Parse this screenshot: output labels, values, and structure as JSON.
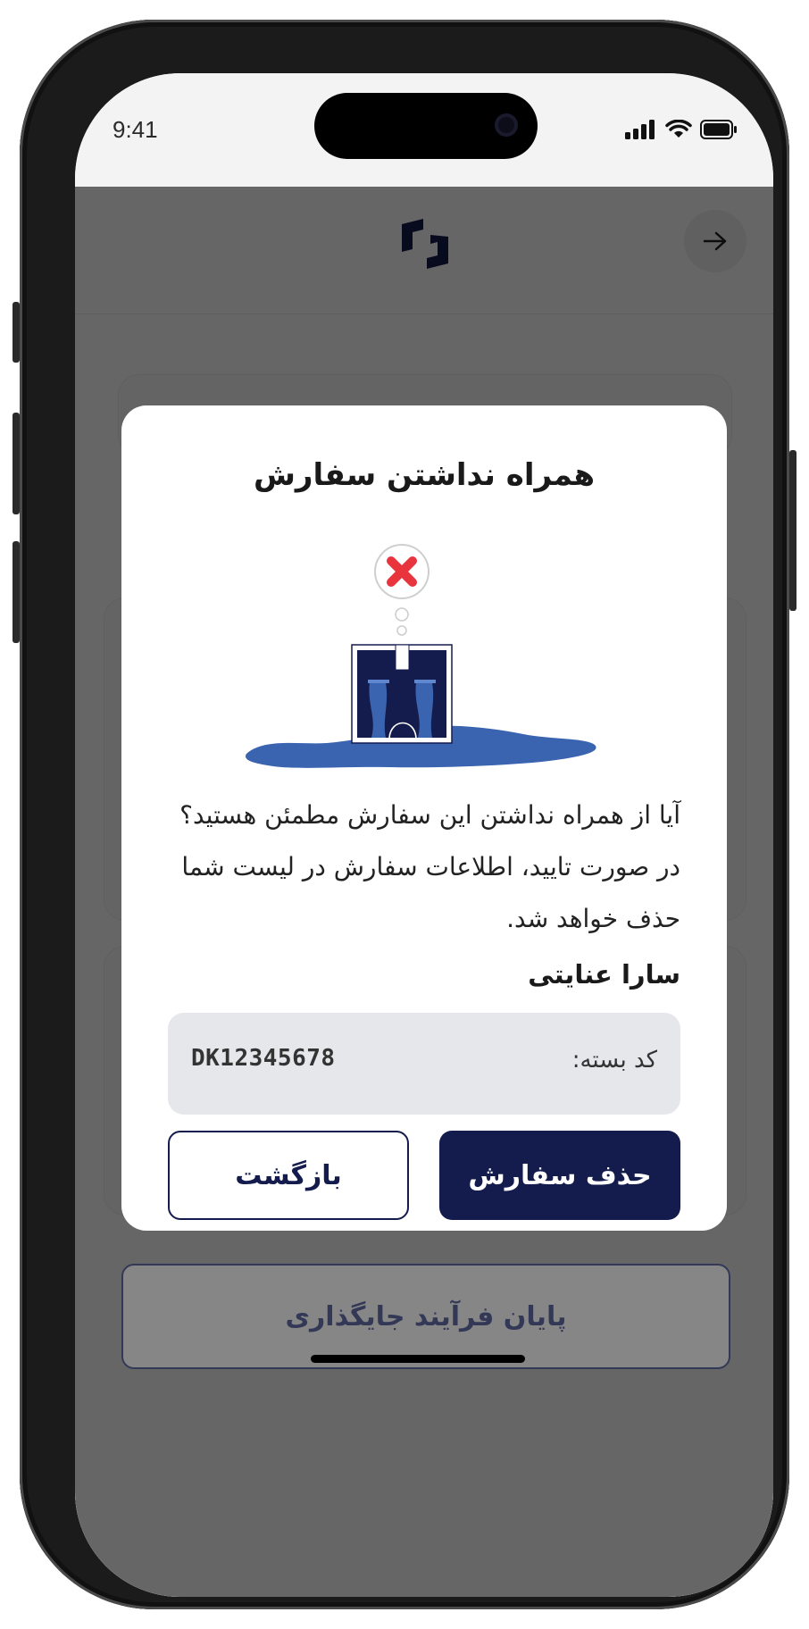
{
  "status_bar": {
    "time": "9:41"
  },
  "modal": {
    "title": "همراه نداشتن سفارش",
    "message": "آیا از همراه نداشتن این سفارش مطمئن هستید؟ در صورت تایید، اطلاعات سفارش در لیست شما حذف خواهد شد.",
    "recipient_name": "سارا عنایتی",
    "package_code_label": "کد بسته:",
    "package_code_value": "DK12345678",
    "delete_button": "حذف سفارش",
    "back_button": "بازگشت"
  },
  "footer": {
    "finish_button": "پایان فرآیند جایگذاری"
  },
  "colors": {
    "primary": "#141c4d",
    "error_red": "#e8343c",
    "water_blue": "#3a63b0"
  },
  "icons": [
    "back-arrow-icon",
    "app-logo",
    "signal-icon",
    "wifi-icon",
    "battery-icon",
    "error-x-icon"
  ]
}
